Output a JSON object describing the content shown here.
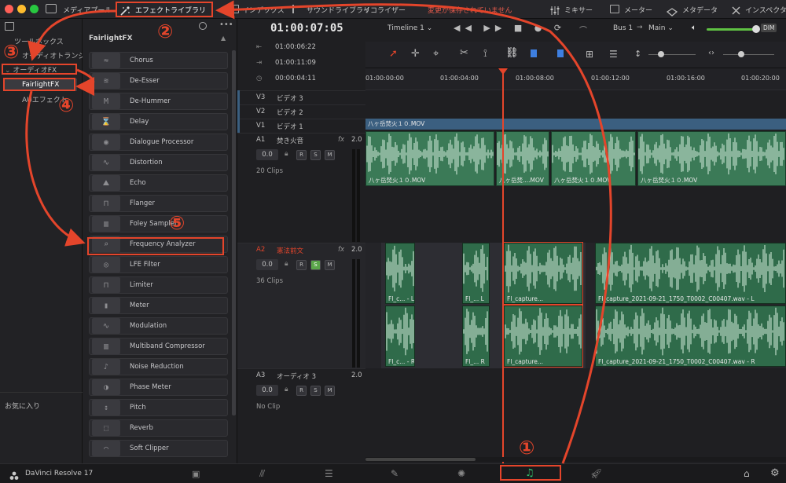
{
  "topbar": {
    "media_pool": "メディアプール",
    "effects_library": "エフェクトライブラリ",
    "index": "インデックス",
    "sound_library": "サウンドライブラリ",
    "equalizer": "イコライザー",
    "unsaved": "変更が保存されていません",
    "mixer": "ミキサー",
    "meters": "メーター",
    "metadata": "メタデータ",
    "inspector": "インスペクタ"
  },
  "sidebar": {
    "toolbox": "ツールボックス",
    "audio_transitions": "オーディオトランジション",
    "audio_fx": "オーディオFX",
    "fairlight_fx": "FairlightFX",
    "au_effects": "AUエフェクト",
    "favorites": "お気に入り"
  },
  "fxpanel": {
    "title": "FairlightFX",
    "items": [
      {
        "label": "Chorus",
        "icon": "≈"
      },
      {
        "label": "De-Esser",
        "icon": "≋"
      },
      {
        "label": "De-Hummer",
        "icon": "M"
      },
      {
        "label": "Delay",
        "icon": "⌛"
      },
      {
        "label": "Dialogue Processor",
        "icon": "◉"
      },
      {
        "label": "Distortion",
        "icon": "∿"
      },
      {
        "label": "Echo",
        "icon": "⛰"
      },
      {
        "label": "Flanger",
        "icon": "⊓"
      },
      {
        "label": "Foley Sampler",
        "icon": "▥"
      },
      {
        "label": "Frequency Analyzer",
        "icon": "⌕"
      },
      {
        "label": "LFE Filter",
        "icon": "◎"
      },
      {
        "label": "Limiter",
        "icon": "⊓"
      },
      {
        "label": "Meter",
        "icon": "▮"
      },
      {
        "label": "Modulation",
        "icon": "∿"
      },
      {
        "label": "Multiband Compressor",
        "icon": "▥"
      },
      {
        "label": "Noise Reduction",
        "icon": "♪"
      },
      {
        "label": "Phase Meter",
        "icon": "◑"
      },
      {
        "label": "Pitch",
        "icon": "↕"
      },
      {
        "label": "Reverb",
        "icon": "⬚"
      },
      {
        "label": "Soft Clipper",
        "icon": "⌒"
      }
    ]
  },
  "transport": {
    "timecode": "01:00:07:05",
    "timeline_name": "Timeline 1",
    "bus": "Bus 1",
    "main": "Main",
    "dim": "DIM"
  },
  "counters": {
    "tc1": "01:00:06:22",
    "tc2": "01:00:11:09",
    "tc3": "00:00:04:11"
  },
  "ruler": [
    "01:00:00:00",
    "01:00:04:00",
    "01:00:08:00",
    "01:00:12:00",
    "01:00:16:00",
    "01:00:20:00"
  ],
  "tracks": {
    "v3": {
      "id": "V3",
      "name": "ビデオ 3"
    },
    "v2": {
      "id": "V2",
      "name": "ビデオ 2"
    },
    "v1": {
      "id": "V1",
      "name": "ビデオ 1"
    },
    "a1": {
      "id": "A1",
      "name": "焚き火音",
      "fx": "fx",
      "ch": "2.0",
      "vol": "0.0",
      "clips": "20 Clips"
    },
    "a2": {
      "id": "A2",
      "name": "憲法前文",
      "fx": "fx",
      "ch": "2.0",
      "vol": "0.0",
      "clips": "36 Clips"
    },
    "a3": {
      "id": "A3",
      "name": "オーディオ 3",
      "ch": "2.0",
      "vol": "0.0",
      "clips": "No Clip"
    }
  },
  "clips": {
    "v1": "八ヶ岳焚火１０.MOV",
    "a1_1": "八ヶ岳焚火１０.MOV",
    "a1_2": "八ヶ岳焚....MOV",
    "a1_3": "八ヶ岳焚火１０.MOV",
    "a1_4": "八ヶ岳焚火１０.MOV",
    "a2_l1": "Fl_c... - L",
    "a2_l2": "Fl_... L",
    "a2_l3": "Fl_capture...",
    "a2_l4": "Fl_capture_2021-09-21_1750_T0002_C00407.wav - L",
    "a2_r1": "Fl_c... - R",
    "a2_r2": "Fl_... R",
    "a2_r3": "Fl_capture...",
    "a2_r4": "Fl_capture_2021-09-21_1750_T0002_C00407.wav - R"
  },
  "bottom": {
    "app": "DaVinci Resolve 17"
  },
  "annotations": {
    "n1": "①",
    "n2": "②",
    "n3": "③",
    "n4": "④",
    "n5": "⑤"
  },
  "colors": {
    "annotation": "#e4452b",
    "audio_clip": "#3b7a57",
    "video_clip": "#3b5f80",
    "playhead": "#e4452b",
    "fairlight_active": "#2fc26b"
  }
}
